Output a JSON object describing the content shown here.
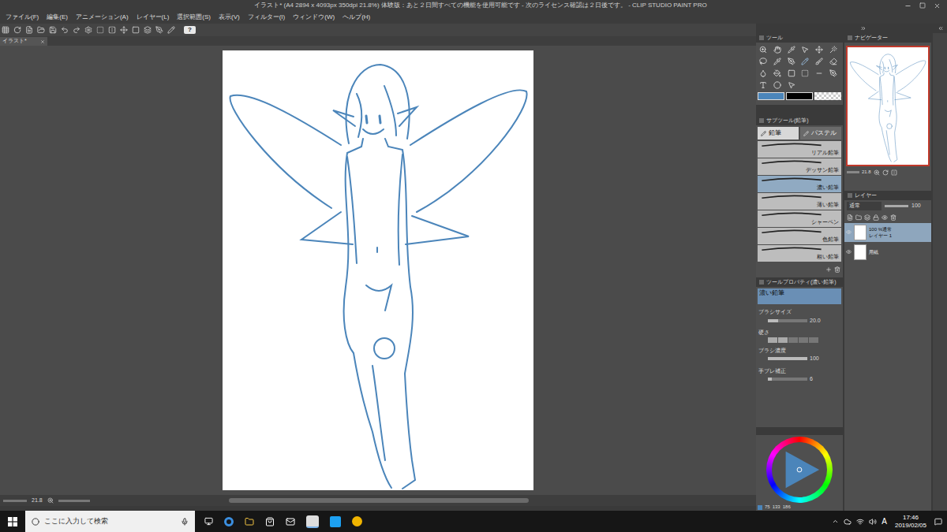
{
  "window": {
    "title": "イラスト* (A4 2894 x 4093px 350dpi 21.8%)  体験版：あと２日間すべての機能を使用可能です - 次のライセンス確認は２日後です。 - CLIP STUDIO PAINT PRO"
  },
  "menu": [
    "ファイル(F)",
    "編集(E)",
    "アニメーション(A)",
    "レイヤー(L)",
    "選択範囲(S)",
    "表示(V)",
    "フィルター(I)",
    "ウィンドウ(W)",
    "ヘルプ(H)"
  ],
  "toolbar": {
    "help_button": "?"
  },
  "document_tab": {
    "label": "イラスト*"
  },
  "canvas": {
    "zoom": "21.8"
  },
  "tool_panel": {
    "title": "ツール"
  },
  "sub_tool_panel": {
    "title": "サブツール(鉛筆)",
    "tabs": [
      {
        "label": "鉛筆",
        "selected": true
      },
      {
        "label": "パステル",
        "selected": false
      }
    ],
    "brushes": [
      {
        "name": "リアル鉛筆",
        "selected": false
      },
      {
        "name": "デッサン鉛筆",
        "selected": false
      },
      {
        "name": "濃い鉛筆",
        "selected": true
      },
      {
        "name": "薄い鉛筆",
        "selected": false
      },
      {
        "name": "シャーペン",
        "selected": false
      },
      {
        "name": "色鉛筆",
        "selected": false
      },
      {
        "name": "粗い鉛筆",
        "selected": false
      }
    ]
  },
  "tool_property": {
    "title": "ツールプロパティ(濃い鉛筆)",
    "brush": "濃い鉛筆",
    "rows": [
      {
        "label": "ブラシサイズ",
        "kind": "slider",
        "value": "20.0",
        "level": 0.25
      },
      {
        "label": "硬さ",
        "kind": "steps",
        "value": "",
        "level": 0.4
      },
      {
        "label": "ブラシ濃度",
        "kind": "slider",
        "value": "100",
        "level": 1
      },
      {
        "label": "手ブレ補正",
        "kind": "slider",
        "value": "6",
        "level": 0.1
      }
    ]
  },
  "navigator": {
    "title": "ナビゲーター",
    "zoom": "21.8"
  },
  "layer_panel": {
    "title": "レイヤー",
    "blend_mode": "通常",
    "opacity": "100",
    "layers": [
      {
        "name": "レイヤー 1",
        "info": "100 %通常",
        "selected": true,
        "visible": true
      },
      {
        "name": "用紙",
        "info": "",
        "selected": false,
        "visible": true
      }
    ]
  },
  "color_panel": {
    "main_color": "#4b85ba",
    "values": [
      "75",
      "133",
      "186"
    ]
  },
  "taskbar": {
    "search_placeholder": "ここに入力して検索",
    "ime": "A",
    "time": "17:46",
    "date": "2019/02/05"
  }
}
